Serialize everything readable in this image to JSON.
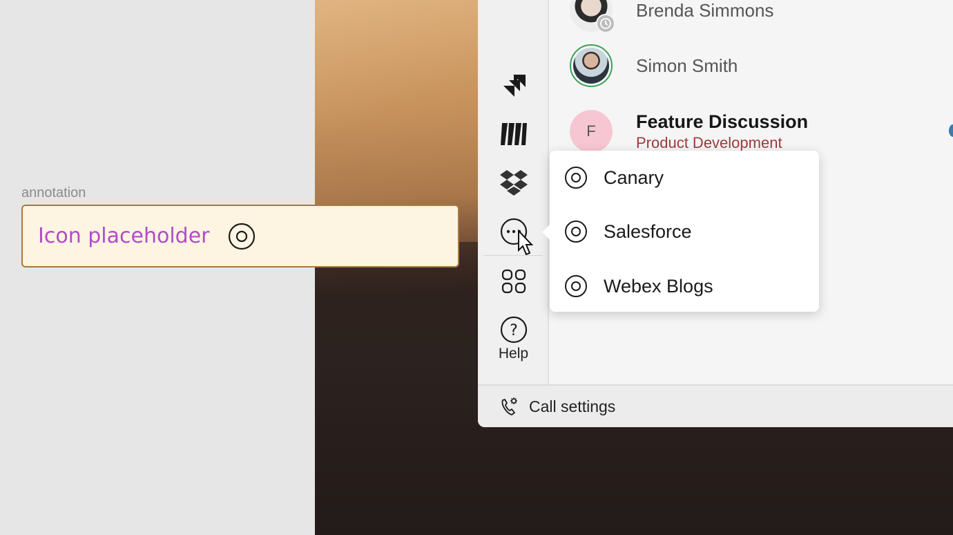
{
  "annotation": {
    "label": "annotation",
    "text": "Icon placeholder",
    "icon": "placeholder-icon"
  },
  "rail": {
    "items": [
      {
        "name": "jira-icon"
      },
      {
        "name": "miro-icon"
      },
      {
        "name": "dropbox-icon"
      },
      {
        "name": "more-icon"
      },
      {
        "name": "apps-icon"
      },
      {
        "name": "help-icon"
      }
    ],
    "help_label": "Help"
  },
  "list": {
    "items": [
      {
        "name": "Brenda Simmons",
        "status": "away"
      },
      {
        "name": "Simon Smith"
      },
      {
        "title": "Feature Discussion",
        "subtitle": "Product Development",
        "initial": "F"
      }
    ]
  },
  "menu": {
    "items": [
      {
        "label": "Canary",
        "icon": "placeholder-icon"
      },
      {
        "label": "Salesforce",
        "icon": "placeholder-icon"
      },
      {
        "label": "Webex Blogs",
        "icon": "placeholder-icon"
      }
    ]
  },
  "footer": {
    "label": "Call settings",
    "icon": "call-settings-icon"
  },
  "colors": {
    "annotation_text": "#b04cc9",
    "annotation_bg": "#fdf4e2",
    "annotation_border": "#a7783e",
    "subtitle": "#9d3a3a",
    "space_avatar_bg": "#f6c7d3",
    "presence_ring": "#3aa055"
  }
}
